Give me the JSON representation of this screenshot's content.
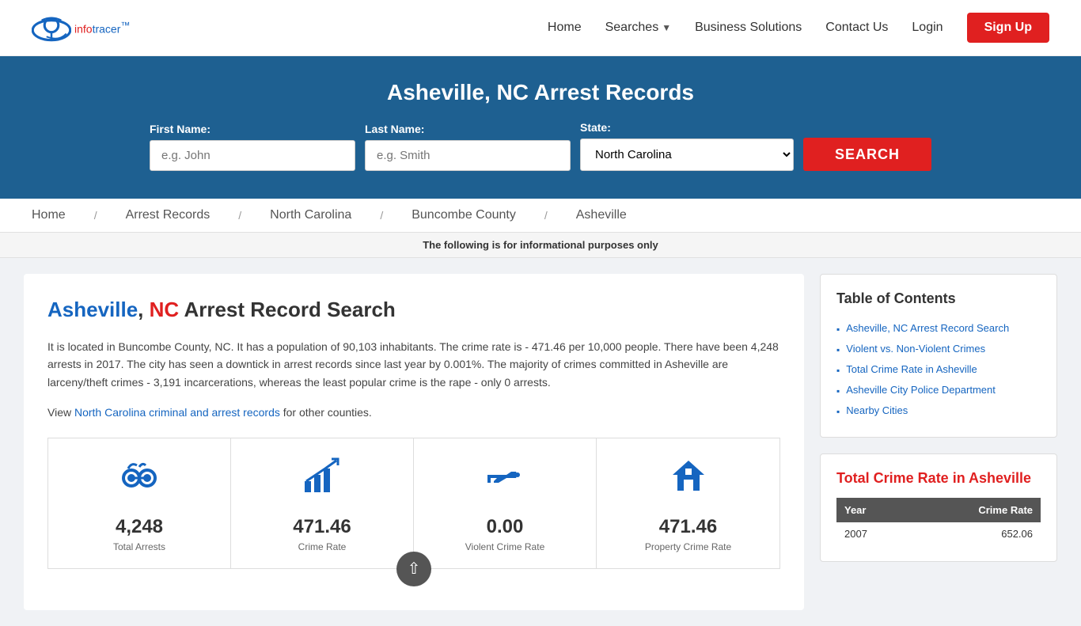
{
  "header": {
    "logo_info": "info",
    "logo_tracer": "tracer",
    "logo_tm": "™",
    "nav": {
      "home": "Home",
      "searches": "Searches",
      "business_solutions": "Business Solutions",
      "contact_us": "Contact Us",
      "login": "Login",
      "signup": "Sign Up"
    }
  },
  "hero": {
    "title": "Asheville, NC Arrest Records",
    "form": {
      "first_name_label": "First Name:",
      "first_name_placeholder": "e.g. John",
      "last_name_label": "Last Name:",
      "last_name_placeholder": "e.g. Smith",
      "state_label": "State:",
      "state_value": "North Carolina",
      "search_button": "SEARCH"
    }
  },
  "breadcrumb": {
    "home": "Home",
    "arrest_records": "Arrest Records",
    "north_carolina": "North Carolina",
    "buncombe_county": "Buncombe County",
    "asheville": "Asheville"
  },
  "disclaimer": "The following is for informational purposes only",
  "content": {
    "heading_part1": "Asheville",
    "heading_part2": ", ",
    "heading_nc": "NC",
    "heading_rest": " Arrest Record Search",
    "description": "It is located in Buncombe County, NC. It has a population of 90,103 inhabitants. The crime rate is - 471.46 per 10,000 people. There have been 4,248 arrests in 2017. The city has seen a downtick in arrest records since last year by 0.001%. The majority of crimes committed in Asheville are larceny/theft crimes - 3,191 incarcerations, whereas the least popular crime is the rape - only 0 arrests.",
    "view_text": "View ",
    "nc_link": "North Carolina criminal and arrest records",
    "for_counties": " for other counties.",
    "stats": [
      {
        "icon": "handcuffs",
        "value": "4,248",
        "label": "Total Arrests"
      },
      {
        "icon": "chart",
        "value": "471.46",
        "label": "Crime Rate"
      },
      {
        "icon": "gun",
        "value": "0.00",
        "label": "Violent Crime Rate"
      },
      {
        "icon": "house",
        "value": "471.46",
        "label": "Property Crime Rate"
      }
    ]
  },
  "sidebar": {
    "toc": {
      "heading": "Table of Contents",
      "items": [
        "Asheville, NC Arrest Record Search",
        "Violent vs. Non-Violent Crimes",
        "Total Crime Rate in Asheville",
        "Asheville City Police Department",
        "Nearby Cities"
      ]
    },
    "crime_rate": {
      "heading": "Total Crime Rate in Asheville",
      "table_headers": [
        "Year",
        "Crime Rate"
      ],
      "rows": [
        {
          "year": "2007",
          "rate": "652.06"
        }
      ]
    }
  }
}
